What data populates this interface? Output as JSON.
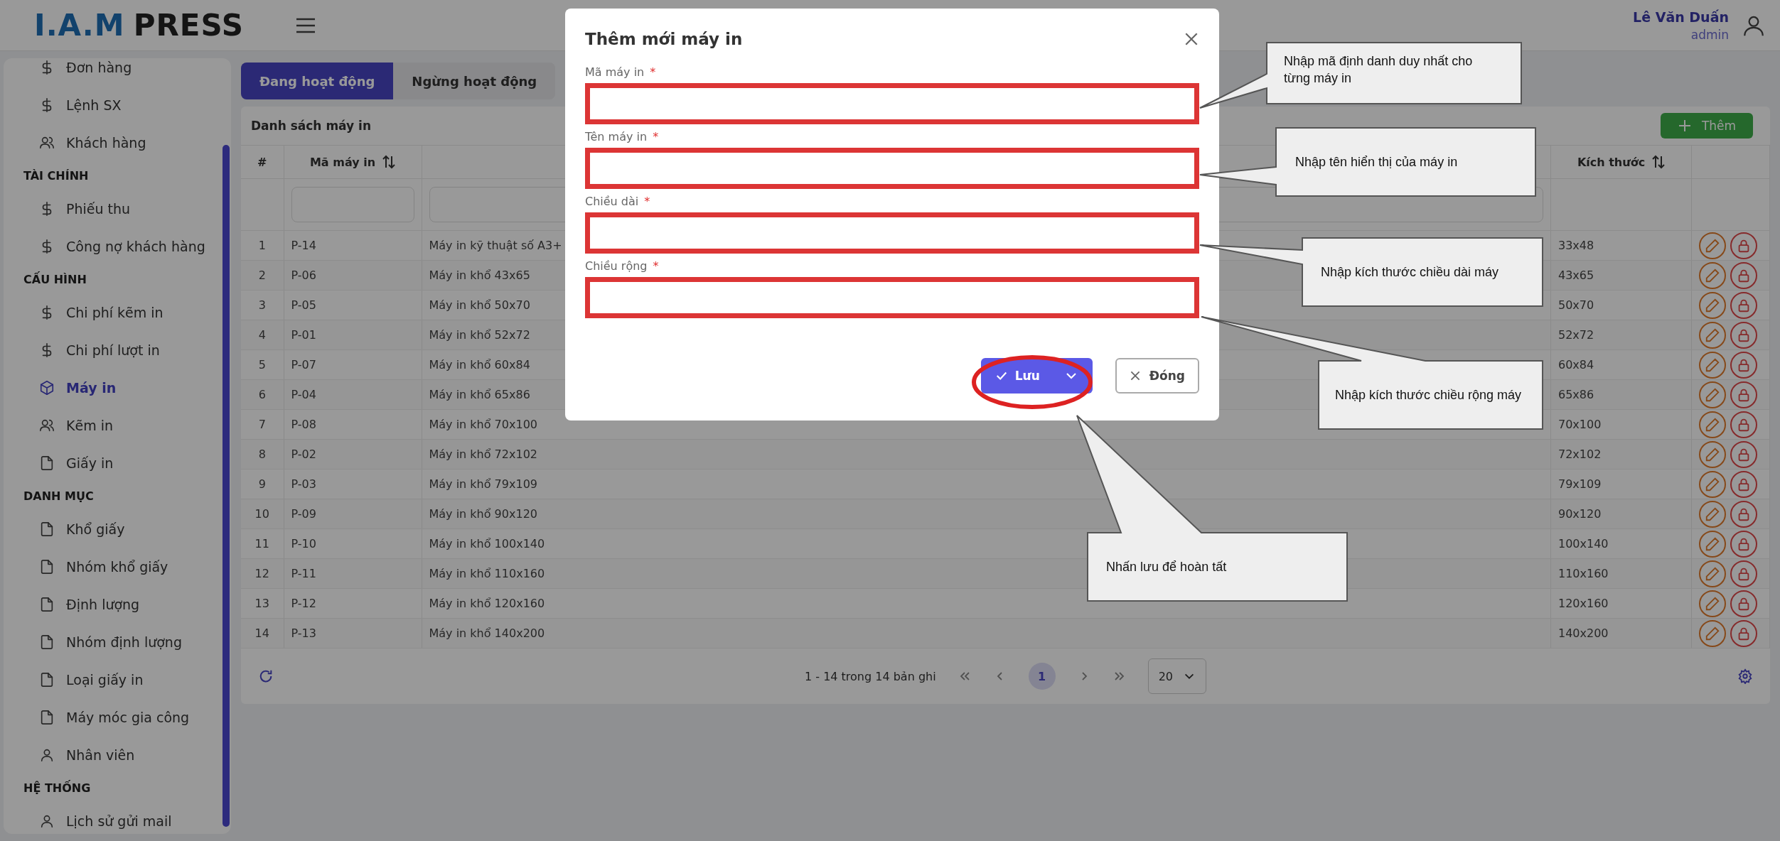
{
  "header": {
    "logo_mark": "I.A.M",
    "logo_word": "PRESS",
    "user_name": "Lê Văn Duấn",
    "user_role": "admin"
  },
  "sidebar": {
    "items": [
      {
        "label": "Đơn hàng",
        "kind": "dollar",
        "selected": false
      },
      {
        "label": "Lệnh SX",
        "kind": "dollar",
        "selected": false
      },
      {
        "label": "Khách hàng",
        "kind": "users",
        "selected": false
      }
    ],
    "sections": [
      {
        "title": "TÀI CHÍNH",
        "items": [
          {
            "label": "Phiếu thu",
            "kind": "dollar",
            "selected": false
          },
          {
            "label": "Công nợ khách hàng",
            "kind": "dollar",
            "selected": false
          }
        ]
      },
      {
        "title": "CẤU HÌNH",
        "items": [
          {
            "label": "Chi phí kẽm in",
            "kind": "dollar",
            "selected": false
          },
          {
            "label": "Chi phí lượt in",
            "kind": "dollar",
            "selected": false
          },
          {
            "label": "Máy in",
            "kind": "cube",
            "selected": true
          },
          {
            "label": "Kẽm in",
            "kind": "users",
            "selected": false
          },
          {
            "label": "Giấy in",
            "kind": "file",
            "selected": false
          }
        ]
      },
      {
        "title": "DANH MỤC",
        "items": [
          {
            "label": "Khổ giấy",
            "kind": "file",
            "selected": false
          },
          {
            "label": "Nhóm khổ giấy",
            "kind": "file",
            "selected": false
          },
          {
            "label": "Định lượng",
            "kind": "file",
            "selected": false
          },
          {
            "label": "Nhóm định lượng",
            "kind": "file",
            "selected": false
          },
          {
            "label": "Loại giấy in",
            "kind": "file",
            "selected": false
          },
          {
            "label": "Máy móc gia công",
            "kind": "file",
            "selected": false
          },
          {
            "label": "Nhân viên",
            "kind": "user",
            "selected": false
          }
        ]
      },
      {
        "title": "HỆ THỐNG",
        "items": [
          {
            "label": "Lịch sử gửi mail",
            "kind": "user",
            "selected": false
          }
        ]
      }
    ]
  },
  "tabs": [
    {
      "label": "Đang hoạt động",
      "selected": true
    },
    {
      "label": "Ngừng hoạt động",
      "selected": false
    }
  ],
  "card": {
    "title": "Danh sách máy in",
    "add_button": "Thêm"
  },
  "table": {
    "columns": [
      {
        "kind": "index",
        "label": "#"
      },
      {
        "kind": "code",
        "label": "Mã máy in",
        "sortable": true,
        "filter": true
      },
      {
        "kind": "name",
        "filter": true
      },
      {
        "kind": "size",
        "label": "Kích thước",
        "sortable": true
      },
      {
        "kind": "actions"
      }
    ],
    "rows": [
      {
        "index": "1",
        "code": "P-14",
        "name": "Máy in kỹ thuật số A3+",
        "size": "33x48"
      },
      {
        "index": "2",
        "code": "P-06",
        "name": "Máy in khổ 43x65",
        "size": "43x65"
      },
      {
        "index": "3",
        "code": "P-05",
        "name": "Máy in khổ 50x70",
        "size": "50x70"
      },
      {
        "index": "4",
        "code": "P-01",
        "name": "Máy in khổ 52x72",
        "size": "52x72"
      },
      {
        "index": "5",
        "code": "P-07",
        "name": "Máy in khổ 60x84",
        "size": "60x84"
      },
      {
        "index": "6",
        "code": "P-04",
        "name": "Máy in khổ 65x86",
        "size": "65x86"
      },
      {
        "index": "7",
        "code": "P-08",
        "name": "Máy in khổ 70x100",
        "size": "70x100"
      },
      {
        "index": "8",
        "code": "P-02",
        "name": "Máy in khổ 72x102",
        "size": "72x102"
      },
      {
        "index": "9",
        "code": "P-03",
        "name": "Máy in khổ 79x109",
        "size": "79x109"
      },
      {
        "index": "10",
        "code": "P-09",
        "name": "Máy in khổ 90x120",
        "size": "90x120"
      },
      {
        "index": "11",
        "code": "P-10",
        "name": "Máy in khổ 100x140",
        "size": "100x140"
      },
      {
        "index": "12",
        "code": "P-11",
        "name": "Máy in khổ 110x160",
        "size": "110x160"
      },
      {
        "index": "13",
        "code": "P-12",
        "name": "Máy in khổ 120x160",
        "size": "120x160"
      },
      {
        "index": "14",
        "code": "P-13",
        "name": "Máy in khổ 140x200",
        "size": "140x200"
      }
    ]
  },
  "pagination": {
    "summary": "1 - 14 trong 14 bản ghi",
    "pages": [
      {
        "label": "1",
        "selected": true
      }
    ],
    "page_size": "20"
  },
  "modal": {
    "title": "Thêm mới máy in",
    "fields": [
      {
        "label": "Mã máy in",
        "required_mark": "*"
      },
      {
        "label": "Tên máy in",
        "required_mark": "*"
      },
      {
        "label": "Chiều dài",
        "required_mark": "*"
      },
      {
        "label": "Chiều rộng",
        "required_mark": "*"
      }
    ],
    "save_button": "Lưu",
    "close_button": "Đóng"
  },
  "callouts": [
    {
      "text": "Nhập mã định danh duy nhất cho từng máy in"
    },
    {
      "text": "Nhập tên hiển thị của máy in"
    },
    {
      "text": "Nhập kích thước chiều dài máy"
    },
    {
      "text": "Nhập kích thước chiều rộng máy"
    },
    {
      "text": "Nhấn lưu để hoàn tất"
    }
  ]
}
